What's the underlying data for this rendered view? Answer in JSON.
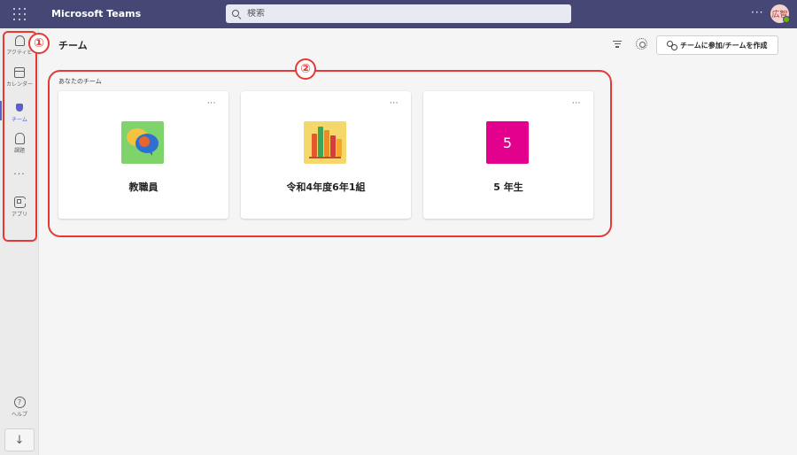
{
  "app": {
    "title": "Microsoft Teams"
  },
  "search": {
    "placeholder": "検索"
  },
  "topbar": {
    "more_label": "···",
    "avatar_initials": "広智"
  },
  "rail": {
    "items": [
      {
        "label": "アクティビ"
      },
      {
        "label": "カレンダー"
      },
      {
        "label": "チーム"
      },
      {
        "label": "課題"
      },
      {
        "label": "···"
      },
      {
        "label": "アプリ"
      }
    ],
    "help_label": "ヘルプ",
    "download_label": "↓"
  },
  "header": {
    "title": "チーム",
    "join_label": "チームに参加/チームを作成"
  },
  "section": {
    "label": "あなたのチーム"
  },
  "teams": [
    {
      "name": "教職員",
      "icon": "chat-bubbles-icon",
      "more": "···"
    },
    {
      "name": "令和4年度6年1組",
      "icon": "books-icon",
      "more": "···"
    },
    {
      "name": "5 年生",
      "icon": "number-tile",
      "tile_text": "5",
      "tile_color": "#e3008c",
      "more": "···"
    }
  ],
  "annotations": {
    "badge_1": "①",
    "badge_2": "②"
  },
  "colors": {
    "topbar": "#464775",
    "accent": "#5b5fc7",
    "annotation": "#e53935"
  }
}
